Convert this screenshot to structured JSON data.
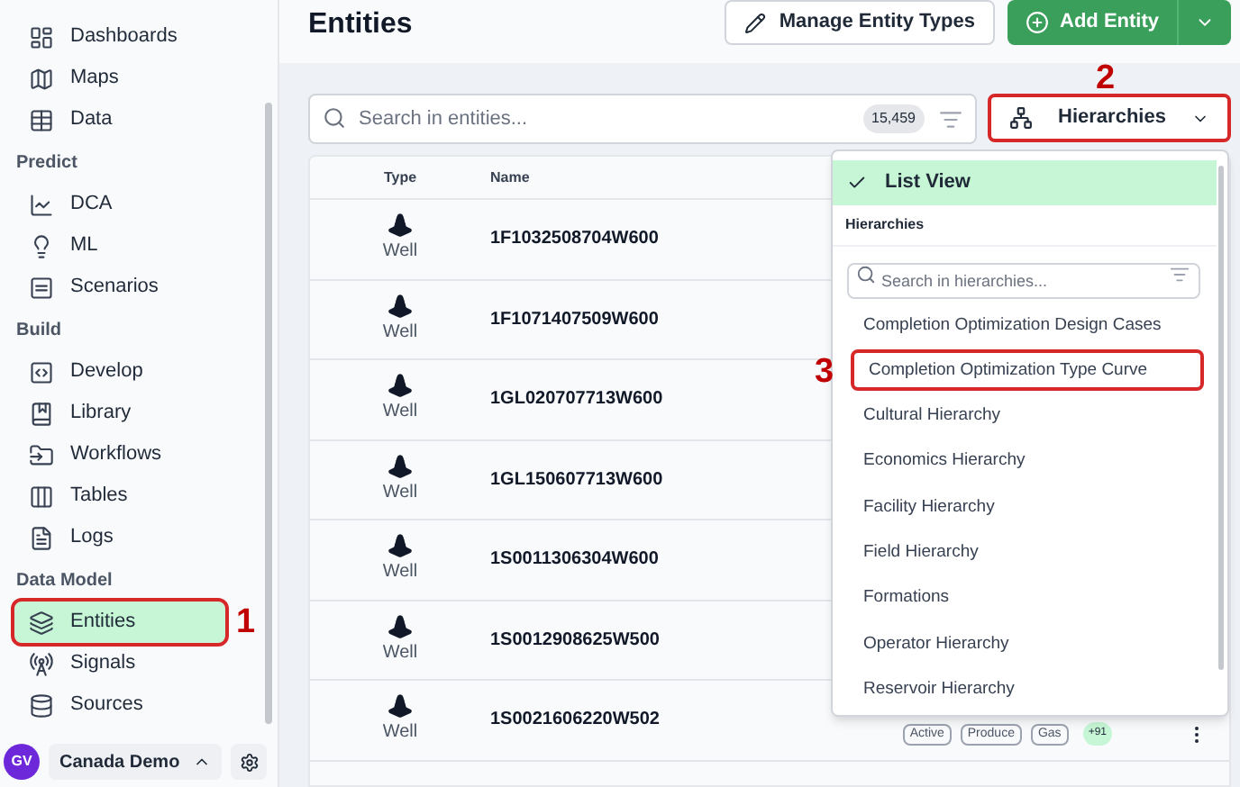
{
  "sidebar": {
    "items": [
      {
        "kind": "link",
        "label": "Dashboards",
        "selected": false
      },
      {
        "kind": "link",
        "label": "Maps",
        "selected": false
      },
      {
        "kind": "link",
        "label": "Data",
        "selected": false
      },
      {
        "kind": "heading",
        "label": "Predict"
      },
      {
        "kind": "link",
        "label": "DCA",
        "selected": false
      },
      {
        "kind": "link",
        "label": "ML",
        "selected": false
      },
      {
        "kind": "link",
        "label": "Scenarios",
        "selected": false
      },
      {
        "kind": "heading",
        "label": "Build"
      },
      {
        "kind": "link",
        "label": "Develop",
        "selected": false
      },
      {
        "kind": "link",
        "label": "Library",
        "selected": false
      },
      {
        "kind": "link",
        "label": "Workflows",
        "selected": false
      },
      {
        "kind": "link",
        "label": "Tables",
        "selected": false
      },
      {
        "kind": "link",
        "label": "Logs",
        "selected": false
      },
      {
        "kind": "heading",
        "label": "Data Model"
      },
      {
        "kind": "link",
        "label": "Entities",
        "selected": true,
        "annotation": "1"
      },
      {
        "kind": "link",
        "label": "Signals",
        "selected": false
      },
      {
        "kind": "link",
        "label": "Sources",
        "selected": false
      }
    ],
    "footer": {
      "avatar": "GV",
      "workspace": "Canada Demo"
    }
  },
  "header": {
    "title": "Entities",
    "manage_button": "Manage Entity Types",
    "add_button": "Add Entity"
  },
  "search": {
    "placeholder": "Search in entities...",
    "count": "15,459"
  },
  "view_button": {
    "label": "Hierarchies",
    "annotation": "2"
  },
  "table": {
    "columns": [
      "Type",
      "Name"
    ],
    "rows": [
      {
        "type": "Well",
        "name": "1F1032508704W600"
      },
      {
        "type": "Well",
        "name": "1F1071407509W600"
      },
      {
        "type": "Well",
        "name": "1GL020707713W600"
      },
      {
        "type": "Well",
        "name": "1GL150607713W600"
      },
      {
        "type": "Well",
        "name": "1S0011306304W600"
      },
      {
        "type": "Well",
        "name": "1S0012908625W500"
      },
      {
        "type": "Well",
        "name": "1S0021606220W502",
        "tags": [
          "Active",
          "Produce",
          "Gas"
        ],
        "more": "+91"
      }
    ]
  },
  "dropdown": {
    "list_view": {
      "label": "List View",
      "selected": true
    },
    "section": "Hierarchies",
    "search_placeholder": "Search in hierarchies...",
    "options": [
      {
        "label": "Completion Optimization Design Cases",
        "selected": false
      },
      {
        "label": "Completion Optimization Type Curve",
        "selected": false,
        "annotation": "3"
      },
      {
        "label": "Cultural Hierarchy",
        "selected": false
      },
      {
        "label": "Economics Hierarchy",
        "selected": false
      },
      {
        "label": "Facility Hierarchy",
        "selected": false
      },
      {
        "label": "Field Hierarchy",
        "selected": false
      },
      {
        "label": "Formations",
        "selected": false
      },
      {
        "label": "Operator Hierarchy",
        "selected": false
      },
      {
        "label": "Reservoir Hierarchy",
        "selected": false
      }
    ]
  }
}
